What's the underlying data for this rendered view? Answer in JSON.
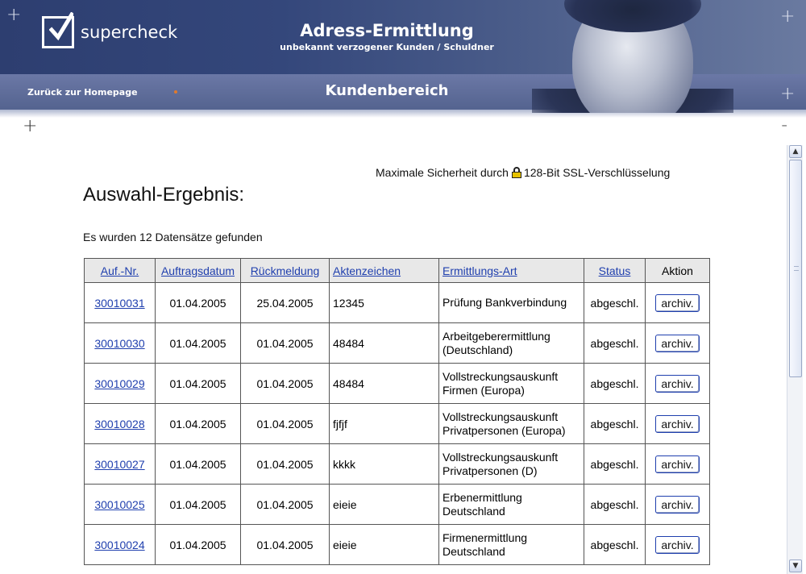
{
  "header": {
    "logo_text": "supercheck",
    "title": "Adress-Ermittlung",
    "subtitle": "unbekannt verzogener Kunden / Schuldner",
    "nav_back": "Zurück zur Homepage",
    "section_title": "Kundenbereich"
  },
  "content": {
    "ssl_prefix": "Maximale Sicherheit durch",
    "ssl_suffix": "128-Bit SSL-Verschlüsselung",
    "heading": "Auswahl-Ergebnis:",
    "result_count": "Es wurden 12 Datensätze gefunden"
  },
  "table": {
    "headers": {
      "nr": "Auf.-Nr.",
      "date": "Auftragsdatum",
      "reply": "Rückmeldung",
      "ref": "Aktenzeichen",
      "type": "Ermittlungs-Art",
      "status": "Status",
      "action": "Aktion"
    },
    "rows": [
      {
        "nr": "30010031",
        "date": "01.04.2005",
        "reply": "25.04.2005",
        "ref": "12345",
        "type": "Prüfung Bankverbindung",
        "status": "abgeschl.",
        "action": "archiv."
      },
      {
        "nr": "30010030",
        "date": "01.04.2005",
        "reply": "01.04.2005",
        "ref": "48484",
        "type": "Arbeitgeberermittlung (Deutschland)",
        "status": "abgeschl.",
        "action": "archiv."
      },
      {
        "nr": "30010029",
        "date": "01.04.2005",
        "reply": "01.04.2005",
        "ref": "48484",
        "type": "Vollstreckungsauskunft Firmen (Europa)",
        "status": "abgeschl.",
        "action": "archiv."
      },
      {
        "nr": "30010028",
        "date": "01.04.2005",
        "reply": "01.04.2005",
        "ref": "fjfjf",
        "type": "Vollstreckungsauskunft Privatpersonen (Europa)",
        "status": "abgeschl.",
        "action": "archiv."
      },
      {
        "nr": "30010027",
        "date": "01.04.2005",
        "reply": "01.04.2005",
        "ref": "kkkk",
        "type": "Vollstreckungsauskunft Privatpersonen (D)",
        "status": "abgeschl.",
        "action": "archiv."
      },
      {
        "nr": "30010025",
        "date": "01.04.2005",
        "reply": "01.04.2005",
        "ref": "eieie",
        "type": "Erbenermittlung Deutschland",
        "status": "abgeschl.",
        "action": "archiv."
      },
      {
        "nr": "30010024",
        "date": "01.04.2005",
        "reply": "01.04.2005",
        "ref": "eieie",
        "type": "Firmenermittlung Deutschland",
        "status": "abgeschl.",
        "action": "archiv."
      }
    ]
  },
  "icons": {
    "logo": "checkbox-check-icon",
    "lock": "padlock-icon",
    "corner": "plus-icon",
    "scroll_up": "arrow-up-icon",
    "scroll_down": "arrow-down-icon"
  },
  "colors": {
    "header_bg": "#2d3e70",
    "nav_bg": "#5b6996",
    "link": "#1f3fae",
    "nav_dot": "#e07a2c",
    "lock": "#e6c200"
  }
}
